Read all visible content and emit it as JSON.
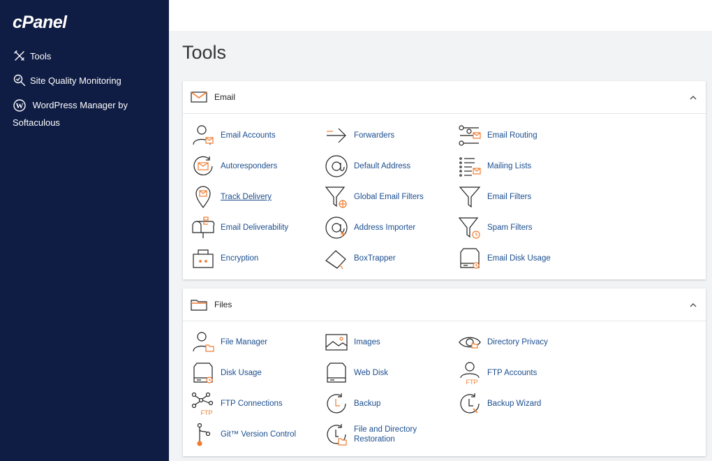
{
  "brand": {
    "logo": "cPanel"
  },
  "sidebar": {
    "items": [
      {
        "label": "Tools",
        "icon": "tools-icon"
      },
      {
        "label": "Site Quality Monitoring",
        "icon": "magnifier-icon"
      },
      {
        "label": "WordPress Manager by Softaculous",
        "icon": "wordpress-icon"
      }
    ]
  },
  "page": {
    "title": "Tools"
  },
  "colors": {
    "sidebar_bg": "#0f1c43",
    "link": "#1a4d8f",
    "accent": "#f07c30"
  },
  "sections": {
    "email": {
      "title": "Email",
      "tools": [
        "Email Accounts",
        "Forwarders",
        "Email Routing",
        "Autoresponders",
        "Default Address",
        "Mailing Lists",
        "Track Delivery",
        "Global Email Filters",
        "Email Filters",
        "Email Deliverability",
        "Address Importer",
        "Spam Filters",
        "Encryption",
        "BoxTrapper",
        "Email Disk Usage"
      ]
    },
    "files": {
      "title": "Files",
      "tools": [
        "File Manager",
        "Images",
        "Directory Privacy",
        "Disk Usage",
        "Web Disk",
        "FTP Accounts",
        "FTP Connections",
        "Backup",
        "Backup Wizard",
        "Git™ Version Control",
        "File and Directory Restoration"
      ]
    }
  }
}
